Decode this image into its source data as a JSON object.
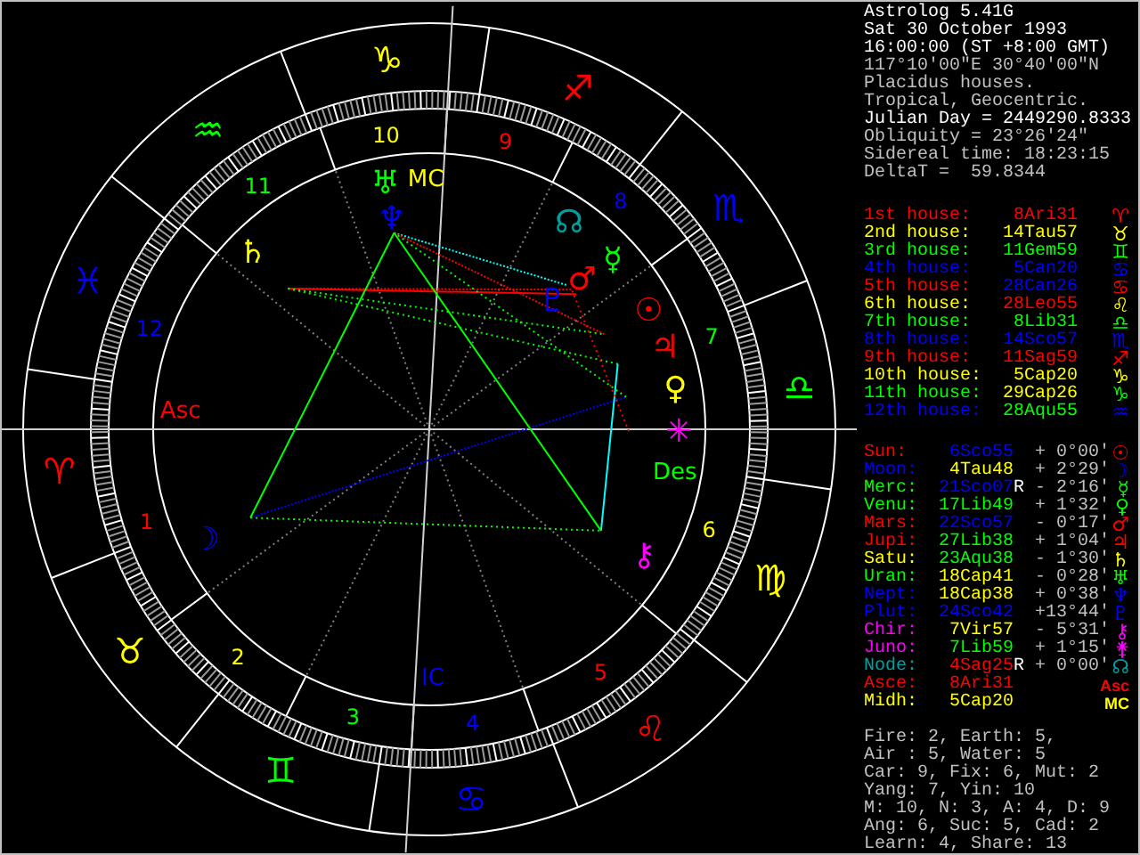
{
  "header": [
    {
      "text": "Astrolog 5.41G",
      "bright": true
    },
    {
      "text": "Sat 30 October 1993",
      "bright": true
    },
    {
      "text": "16:00:00 (ST +8:00 GMT)",
      "bright": true
    },
    {
      "text": "117°10'00\"E 30°40'00\"N",
      "bright": false
    },
    {
      "text": "Placidus houses.",
      "bright": false
    },
    {
      "text": "Tropical, Geocentric.",
      "bright": false
    },
    {
      "text": "Julian Day = 2449290.8333",
      "bright": true
    },
    {
      "text": "Obliquity = 23°26'24\"",
      "bright": false
    },
    {
      "text": "Sidereal time: 18:23:15",
      "bright": false
    },
    {
      "text": "DeltaT =  59.8344",
      "bright": false
    }
  ],
  "houses": [
    {
      "label": "1st house:",
      "position": {
        "text": "8Ari31",
        "color": "#ff0000"
      },
      "glyph": "♈",
      "color": "#ff0000"
    },
    {
      "label": "2nd house:",
      "position": {
        "text": "14Tau57",
        "color": "#ffff00"
      },
      "glyph": "♉",
      "color": "#ffff00"
    },
    {
      "label": "3rd house:",
      "position": {
        "text": "11Gem59",
        "color": "#00ff00"
      },
      "glyph": "♊",
      "color": "#00ff00"
    },
    {
      "label": "4th house:",
      "position": {
        "text": "5Can20",
        "color": "#0000ff"
      },
      "glyph": "♋",
      "color": "#0000ff"
    },
    {
      "label": "5th house:",
      "position": {
        "text": "28Can26",
        "color": "#0000ff"
      },
      "glyph": "♋",
      "color": "#ff0000"
    },
    {
      "label": "6th house:",
      "position": {
        "text": "28Leo55",
        "color": "#ff0000"
      },
      "glyph": "♌",
      "color": "#ffff00"
    },
    {
      "label": "7th house:",
      "position": {
        "text": "8Lib31",
        "color": "#00ff00"
      },
      "glyph": "♎",
      "color": "#00ff00"
    },
    {
      "label": "8th house:",
      "position": {
        "text": "14Sco57",
        "color": "#0000ff"
      },
      "glyph": "♏",
      "color": "#0000ff"
    },
    {
      "label": "9th house:",
      "position": {
        "text": "11Sag59",
        "color": "#ff0000"
      },
      "glyph": "♐",
      "color": "#ff0000"
    },
    {
      "label": "10th house:",
      "position": {
        "text": "5Cap20",
        "color": "#ffff00"
      },
      "glyph": "♑",
      "color": "#ffff00"
    },
    {
      "label": "11th house:",
      "position": {
        "text": "29Cap26",
        "color": "#ffff00"
      },
      "glyph": "♑",
      "color": "#00ff00"
    },
    {
      "label": "12th house:",
      "position": {
        "text": "28Aqu55",
        "color": "#00ff00"
      },
      "glyph": "♒",
      "color": "#0000ff"
    }
  ],
  "planets": [
    {
      "label": "Sun:",
      "position": {
        "text": "6Sco55",
        "color": "#0000ff"
      },
      "latitude": "+ 0°00'",
      "glyph": "☉",
      "color": "#ff0000"
    },
    {
      "label": "Moon:",
      "position": {
        "text": "4Tau48",
        "color": "#ffff00"
      },
      "latitude": "+ 2°29'",
      "glyph": "☽",
      "color": "#0000ff"
    },
    {
      "label": "Merc:",
      "position": {
        "text": "21Sco07",
        "color": "#0000ff"
      },
      "motion": "R",
      "latitude": "- 2°16'",
      "glyph": "☿",
      "color": "#00ff00"
    },
    {
      "label": "Venu:",
      "position": {
        "text": "17Lib49",
        "color": "#00ff00"
      },
      "latitude": "+ 1°32'",
      "glyph": "♀",
      "color": "#00ff00"
    },
    {
      "label": "Mars:",
      "position": {
        "text": "22Sco57",
        "color": "#0000ff"
      },
      "latitude": "- 0°17'",
      "glyph": "♂",
      "color": "#ff0000"
    },
    {
      "label": "Jupi:",
      "position": {
        "text": "27Lib38",
        "color": "#00ff00"
      },
      "latitude": "+ 1°04'",
      "glyph": "♃",
      "color": "#ff0000"
    },
    {
      "label": "Satu:",
      "position": {
        "text": "23Aqu38",
        "color": "#00ff00"
      },
      "latitude": "- 1°30'",
      "glyph": "♄",
      "color": "#ffff00"
    },
    {
      "label": "Uran:",
      "position": {
        "text": "18Cap41",
        "color": "#ffff00"
      },
      "latitude": "- 0°28'",
      "glyph": "♅",
      "color": "#00ff00"
    },
    {
      "label": "Nept:",
      "position": {
        "text": "18Cap38",
        "color": "#ffff00"
      },
      "latitude": "+ 0°38'",
      "glyph": "♆",
      "color": "#0000ff"
    },
    {
      "label": "Plut:",
      "position": {
        "text": "24Sco42",
        "color": "#0000ff"
      },
      "latitude": "+13°44'",
      "glyph": "♇",
      "color": "#0000ff"
    },
    {
      "label": "Chir:",
      "position": {
        "text": "7Vir57",
        "color": "#ffff00"
      },
      "latitude": "- 5°31'",
      "glyph": "⚷",
      "color": "#ff00ff"
    },
    {
      "label": "Juno:",
      "position": {
        "text": "7Lib59",
        "color": "#00ff00"
      },
      "latitude": "+ 1°15'",
      "glyph": "⚵",
      "color": "#ff00ff"
    },
    {
      "label": "Node:",
      "position": {
        "text": "4Sag25",
        "color": "#ff0000"
      },
      "motion": "R",
      "latitude": "+ 0°00'",
      "glyph": "☊",
      "color": "#00a0a0"
    },
    {
      "label": "Asce:",
      "position": {
        "text": "8Ari31",
        "color": "#ff0000"
      },
      "glyph": "Asc",
      "color": "#ff0000"
    },
    {
      "label": "Midh:",
      "position": {
        "text": "5Cap20",
        "color": "#ffff00"
      },
      "glyph": "MC",
      "color": "#ffff00"
    }
  ],
  "summary": [
    "Fire: 2, Earth: 5,",
    "Air : 5, Water: 5",
    "Car: 9, Fix: 6, Mut: 2",
    "Yang: 7, Yin: 10",
    "M: 10, N: 3, A: 4, D: 9",
    "Ang: 6, Suc: 5, Cad: 2",
    "Learn: 4, Share: 13"
  ],
  "wheel": {
    "signs": [
      {
        "glyph": "♈",
        "color": "#ff0000"
      },
      {
        "glyph": "♉",
        "color": "#ffff00"
      },
      {
        "glyph": "♊",
        "color": "#00ff00"
      },
      {
        "glyph": "♋",
        "color": "#0000ff"
      },
      {
        "glyph": "♌",
        "color": "#ff0000"
      },
      {
        "glyph": "♍",
        "color": "#ffff00"
      },
      {
        "glyph": "♎",
        "color": "#00ff00"
      },
      {
        "glyph": "♏",
        "color": "#0000ff"
      },
      {
        "glyph": "♐",
        "color": "#ff0000"
      },
      {
        "glyph": "♑",
        "color": "#ffff00"
      },
      {
        "glyph": "♒",
        "color": "#00ff00"
      },
      {
        "glyph": "♓",
        "color": "#0000ff"
      }
    ],
    "house_numbers": [
      {
        "number": "1",
        "color": "#ff0000"
      },
      {
        "number": "2",
        "color": "#ffff00"
      },
      {
        "number": "3",
        "color": "#00ff00"
      },
      {
        "number": "4",
        "color": "#0000ff"
      },
      {
        "number": "5",
        "color": "#ff0000"
      },
      {
        "number": "6",
        "color": "#ffff00"
      },
      {
        "number": "7",
        "color": "#00ff00"
      },
      {
        "number": "8",
        "color": "#0000ff"
      },
      {
        "number": "9",
        "color": "#ff0000"
      },
      {
        "number": "10",
        "color": "#ffff00"
      },
      {
        "number": "11",
        "color": "#00ff00"
      },
      {
        "number": "12",
        "color": "#0000ff"
      }
    ],
    "planets": [
      {
        "glyph": "☉",
        "color": "#ff0000"
      },
      {
        "glyph": "☽",
        "color": "#0000ff"
      },
      {
        "glyph": "☿",
        "color": "#00ff00"
      },
      {
        "glyph": "♀",
        "color": "#ffff00"
      },
      {
        "glyph": "♂",
        "color": "#ff0000"
      },
      {
        "glyph": "♃",
        "color": "#ff0000"
      },
      {
        "glyph": "♄",
        "color": "#ffff00"
      },
      {
        "glyph": "♅",
        "color": "#00ff00"
      },
      {
        "glyph": "♆",
        "color": "#0000ff"
      },
      {
        "glyph": "♇",
        "color": "#0000ff"
      },
      {
        "glyph": "⚷",
        "color": "#ff00ff"
      },
      {
        "glyph": "✳",
        "color": "#ff00ff"
      },
      {
        "glyph": "☊",
        "color": "#00a0a0"
      }
    ],
    "angles": [
      {
        "label": "Asc",
        "color": "#ff0000"
      },
      {
        "label": "Des",
        "color": "#00ff00"
      },
      {
        "label": "MC",
        "color": "#ffff00"
      },
      {
        "label": "IC",
        "color": "#0000ff"
      }
    ]
  }
}
